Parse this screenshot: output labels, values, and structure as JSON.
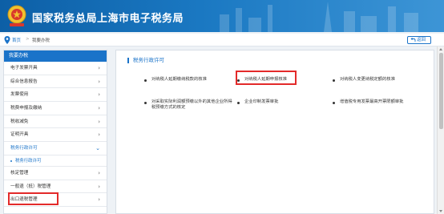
{
  "header": {
    "title": "国家税务总局上海市电子税务局"
  },
  "breadcrumb": {
    "home": "首页",
    "separator": ">",
    "current": "我要办税"
  },
  "back_button": {
    "label": "返回"
  },
  "sidebar": {
    "heading": "我要办税",
    "items": [
      {
        "label": "电子发票开具",
        "chev": "›"
      },
      {
        "label": "综合信息报告",
        "chev": "›"
      },
      {
        "label": "发票使用",
        "chev": "›"
      },
      {
        "label": "税费申报及缴纳",
        "chev": "›"
      },
      {
        "label": "税收减免",
        "chev": "›"
      },
      {
        "label": "证明开具",
        "chev": "›"
      },
      {
        "label": "税务行政许可",
        "chev": "⌄"
      },
      {
        "label": "核定管理",
        "chev": "›"
      },
      {
        "label": "一般退（抵）税管理",
        "chev": "›"
      },
      {
        "label": "出口退税管理",
        "chev": "›"
      }
    ],
    "sub_items": [
      {
        "label": "税务行政许可"
      }
    ],
    "highlighted_item": "税务行政许可"
  },
  "main": {
    "section_title": "税务行政许可",
    "links": [
      {
        "text": "对纳税人延期缴纳税款的核准"
      },
      {
        "text": "对纳税人延期申报核准"
      },
      {
        "text": "对纳税人变更纳税定额的核准"
      },
      {
        "text": "对采取实际利润额预缴以外的其他企业所得税预缴方式的核定"
      },
      {
        "text": "企业印制发票审批"
      },
      {
        "text": "增值税专用发票最高开票限额审批"
      }
    ],
    "highlighted_link": "对纳税人延期申报核准"
  },
  "colors": {
    "accent": "#1a73c9",
    "highlight_red": "#e32a2a",
    "header_blue": "#0d5fa6"
  }
}
